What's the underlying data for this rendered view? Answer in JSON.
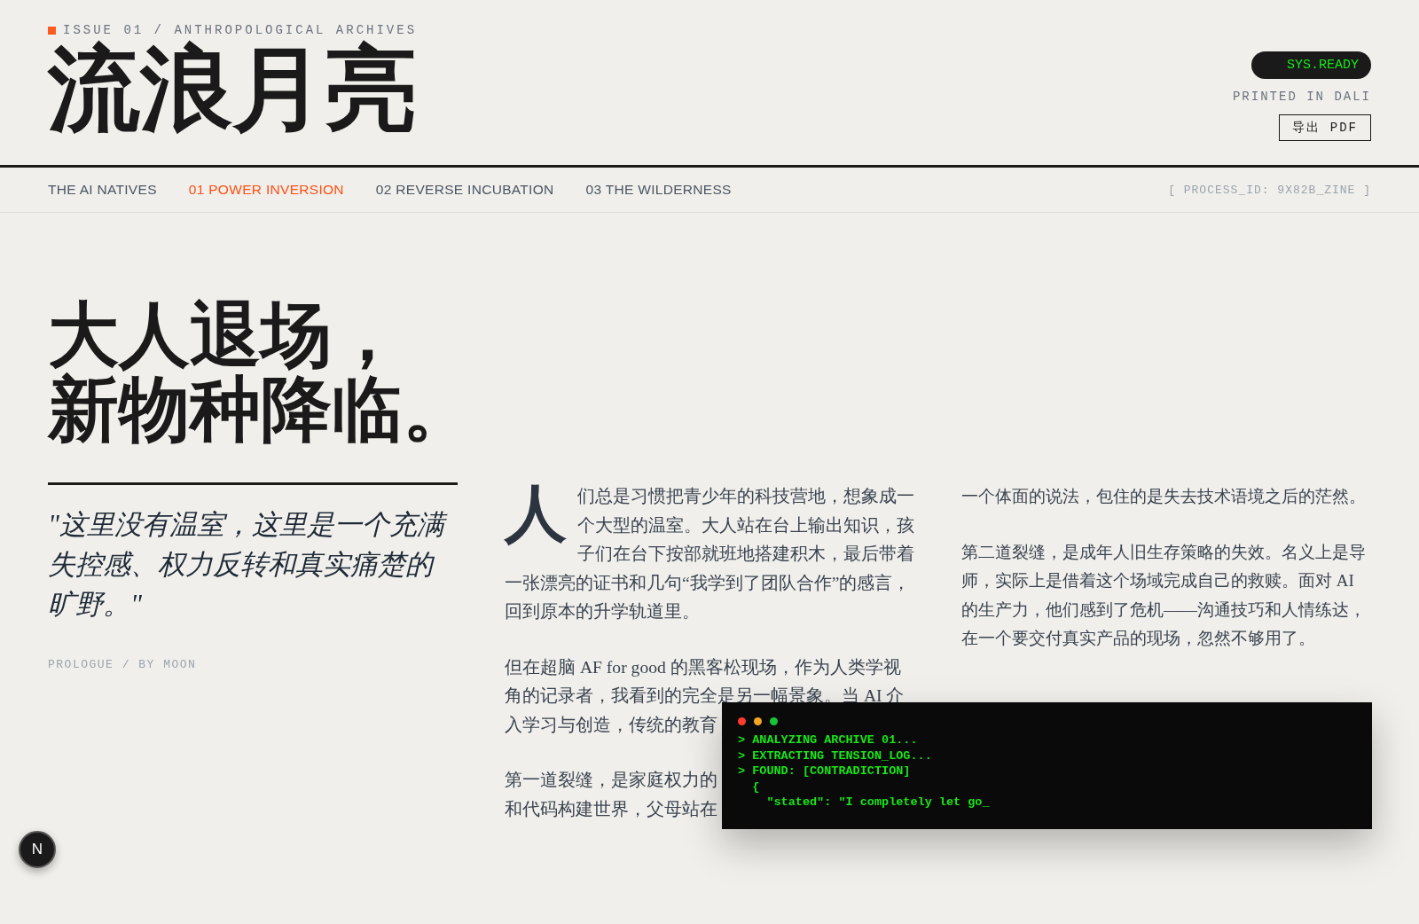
{
  "header": {
    "issue": "ISSUE 01 / ANTHROPOLOGICAL ARCHIVES",
    "title": "流浪月亮",
    "status_pill": "SYS.READY",
    "printed": "PRINTED IN DALI",
    "export_button": "导出 PDF"
  },
  "nav": {
    "items": [
      {
        "label": "THE AI NATIVES",
        "selected": false
      },
      {
        "label": "01 POWER INVERSION",
        "selected": true
      },
      {
        "label": "02 REVERSE INCUBATION",
        "selected": false
      },
      {
        "label": "03 THE WILDERNESS",
        "selected": false
      }
    ],
    "process_id": "[ PROCESS_ID: 9X82B_ZINE ]"
  },
  "headline": [
    "大人退场，",
    "新物种降临。"
  ],
  "pull_quote": {
    "text": "\"这里没有温室，这里是一个充满失控感、权力反转和真实痛楚的旷野。\"",
    "byline": "PROLOGUE / BY MOON"
  },
  "column_2": [
    {
      "kind": "dropcap",
      "drop": "人",
      "text": "们总是习惯把青少年的科技营地，想象成一个大型的温室。大人站在台上输出知识，孩子们在台下按部就班地搭建积木，最后带着一张漂亮的证书和几句“我学到了团队合作”的感言，回到原本的升学轨道里。"
    },
    {
      "kind": "lines",
      "lines": [
        "但在超脑 AF for good 的黑客松现场，作为人类学视",
        "角的记录者，我看到的完全是另一幅景象。当 AI 介",
        "入学习与创造，传统的教育"
      ]
    },
    {
      "kind": "lines",
      "lines": [
        "第一道裂缝，是家庭权力的",
        "和代码构建世界，父母站在"
      ]
    }
  ],
  "column_3": [
    {
      "kind": "plain",
      "text": "一个体面的说法，包住的是失去技术语境之后的茫然。"
    },
    {
      "kind": "plain",
      "text": "第二道裂缝，是成年人旧生存策略的失效。名义上是导师，实际上是借着这个场域完成自己的救赎。面对 AI 的生产力，他们感到了危机——沟通技巧和人情练达，在一个要交付真实产品的现场，忽然不够用了。"
    }
  ],
  "terminal": {
    "lines": [
      "> ANALYZING ARCHIVE 01...",
      "> EXTRACTING TENSION_LOG...",
      "> FOUND: [CONTRADICTION]",
      "  {",
      "    \"stated\": \"I completely let go_"
    ]
  },
  "dev_badge": {
    "label": "N"
  }
}
